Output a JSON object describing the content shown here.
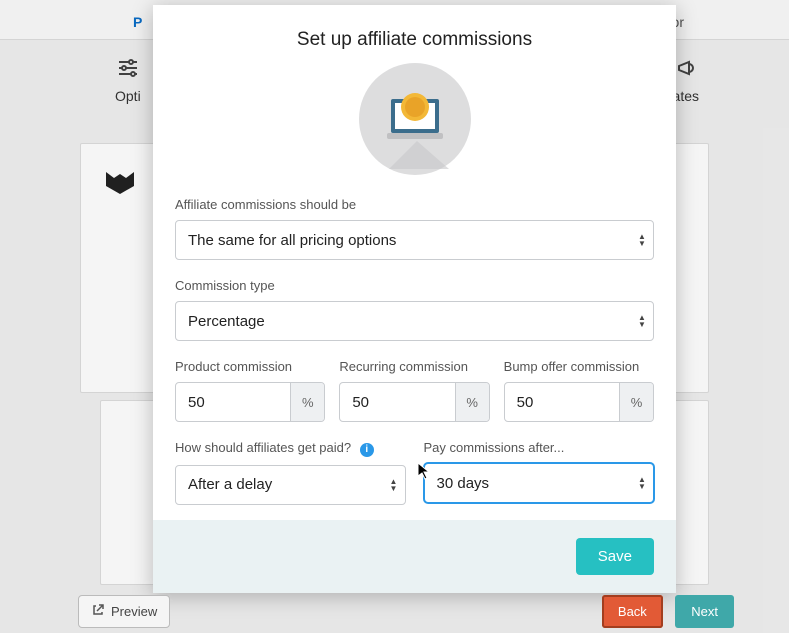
{
  "bg": {
    "nav_left": "P",
    "nav_right": "or",
    "tab_left": "Opti",
    "tab_right": "ates"
  },
  "modal": {
    "title": "Set up affiliate commissions",
    "scope_label": "Affiliate commissions should be",
    "scope_value": "The same for all pricing options",
    "type_label": "Commission type",
    "type_value": "Percentage",
    "product_label": "Product commission",
    "product_value": "50",
    "recurring_label": "Recurring commission",
    "recurring_value": "50",
    "bump_label": "Bump offer commission",
    "bump_value": "50",
    "suffix": "%",
    "paid_label": "How should affiliates get paid?",
    "paid_value": "After a delay",
    "delay_label": "Pay commissions after...",
    "delay_value": "30 days",
    "save": "Save"
  },
  "buttons": {
    "preview": "Preview",
    "back": "Back",
    "next": "Next"
  },
  "info_char": "i"
}
